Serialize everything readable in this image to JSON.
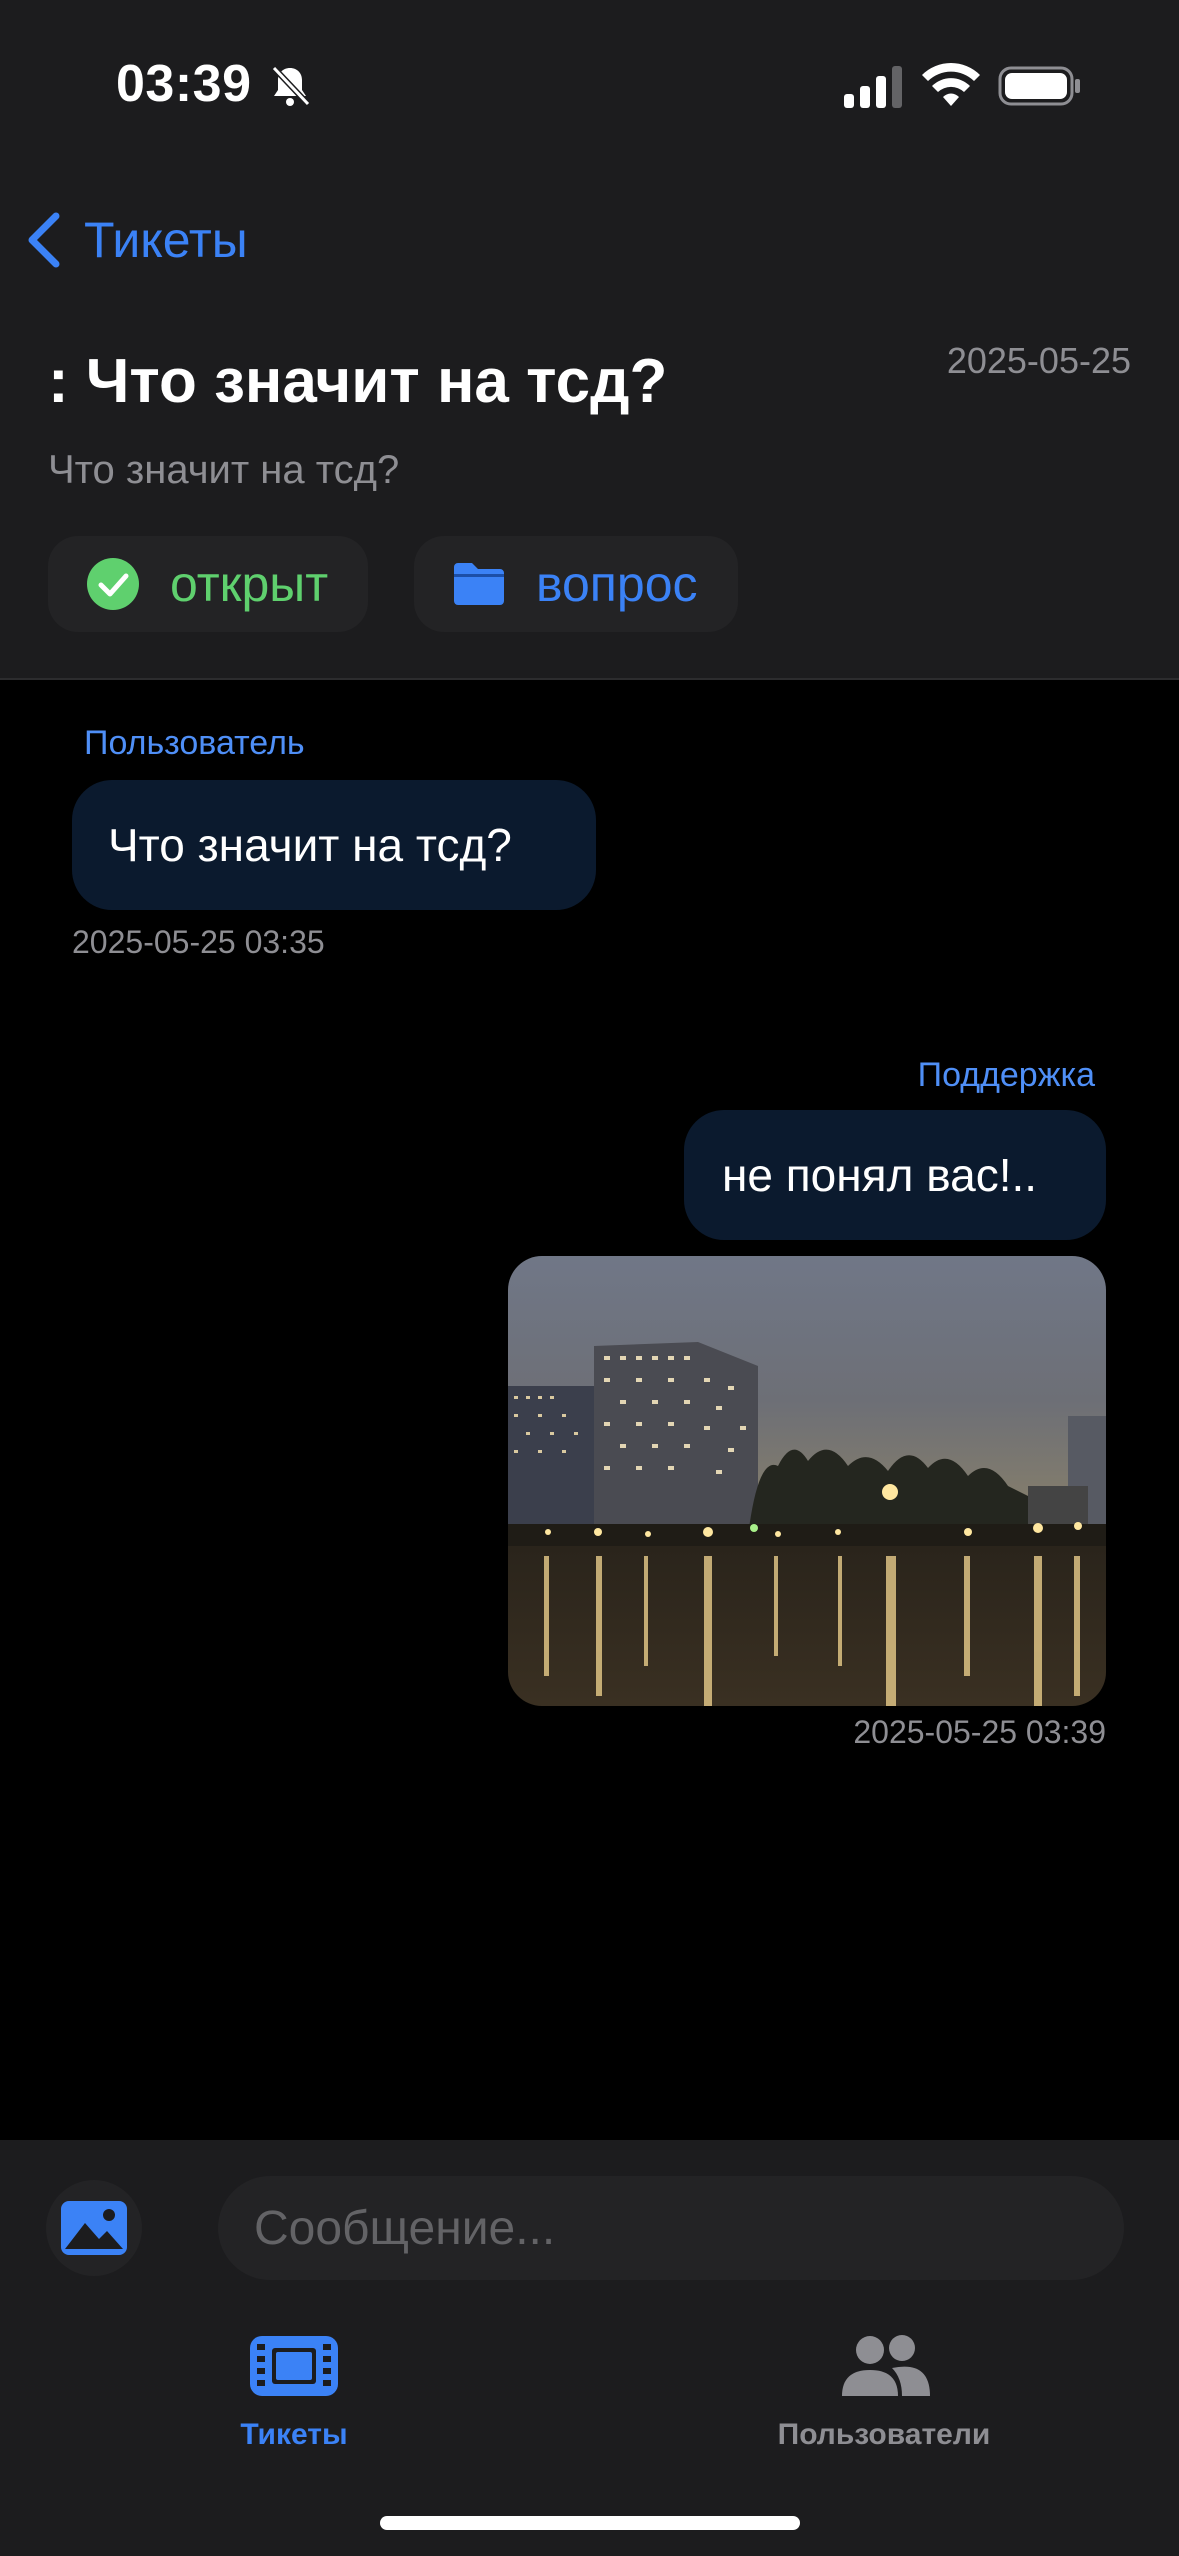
{
  "status_bar": {
    "time": "03:39",
    "icons": [
      "bell-slash-icon",
      "signal-icon",
      "wifi-icon",
      "battery-icon"
    ]
  },
  "header": {
    "back_label": "Тикеты",
    "title": ": Что значит на тсд?",
    "date": "2025-05-25",
    "subtitle": "Что значит на тсд?",
    "status_tag": {
      "label": "открыт",
      "icon": "checkmark-circle-icon",
      "color": "#5fd06e"
    },
    "category_tag": {
      "label": "вопрос",
      "icon": "folder-icon",
      "color": "#3b82f6"
    }
  },
  "messages": [
    {
      "sender": "Пользователь",
      "text": "Что значит на тсд?",
      "timestamp": "2025-05-25 03:35",
      "side": "left"
    },
    {
      "sender": "Поддержка",
      "text": "не понял вас!..",
      "attachment": "photo",
      "timestamp": "2025-05-25 03:39",
      "side": "right"
    }
  ],
  "composer": {
    "placeholder": "Сообщение...",
    "attach_icon": "photo-icon"
  },
  "tab_bar": {
    "tabs": [
      {
        "label": "Тикеты",
        "icon": "film-icon",
        "active": true
      },
      {
        "label": "Пользователи",
        "icon": "users-icon",
        "active": false
      }
    ]
  },
  "colors": {
    "accent": "#3b82f6",
    "success": "#5fd06e",
    "background": "#000000",
    "surface": "#1c1c1e",
    "bubble": "#0b1a2e",
    "muted": "#8e8e93"
  }
}
